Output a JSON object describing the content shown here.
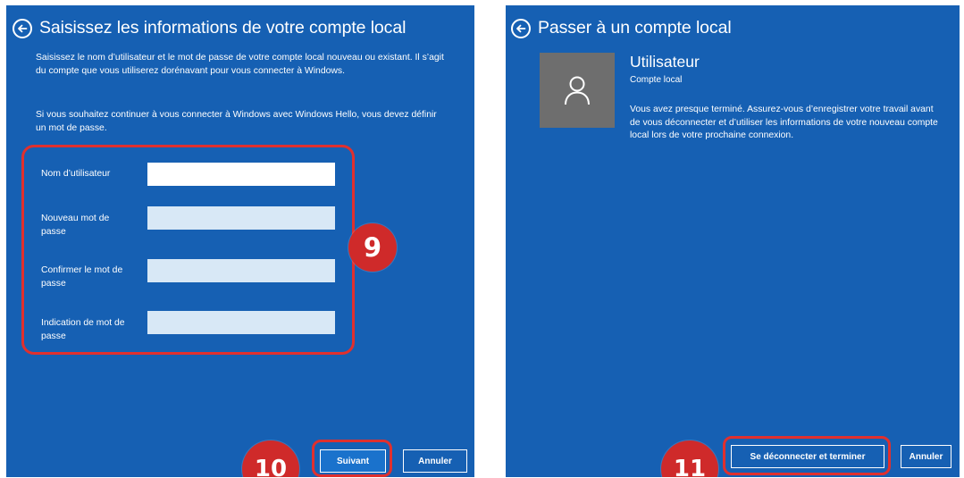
{
  "left": {
    "title": "Saisissez les informations de votre compte local",
    "paragraph1": "Saisissez le nom d’utilisateur et le mot de passe de votre compte local nouveau ou existant. Il s’agit du compte que vous utiliserez dorénavant pour vous connecter à Windows.",
    "paragraph2": "Si vous souhaitez continuer à vous connecter à Windows avec Windows Hello, vous devez définir un mot de passe.",
    "fields": [
      {
        "label": "Nom d’utilisateur",
        "value": ""
      },
      {
        "label": "Nouveau mot de passe",
        "value": ""
      },
      {
        "label": "Confirmer le mot de passe",
        "value": ""
      },
      {
        "label": "Indication de mot de passe",
        "value": ""
      }
    ],
    "next_label": "Suivant",
    "cancel_label": "Annuler"
  },
  "right": {
    "title": "Passer à un compte local",
    "user_name": "Utilisateur",
    "account_type": "Compte local",
    "message": "Vous avez presque terminé. Assurez-vous d’enregistrer votre travail avant de vous déconnecter et d’utiliser les informations de votre nouveau compte local lors de votre prochaine connexion.",
    "signout_label": "Se déconnecter et terminer",
    "cancel_label": "Annuler"
  },
  "badges": {
    "step9": "9",
    "step10": "10",
    "step11": "11"
  },
  "colors": {
    "panel_bg": "#1660b3",
    "highlight": "#e0302e",
    "badge": "#cf2a2a",
    "avatar": "#6e6e6e"
  },
  "icons": {
    "back": "back-arrow-icon",
    "user": "user-icon"
  }
}
